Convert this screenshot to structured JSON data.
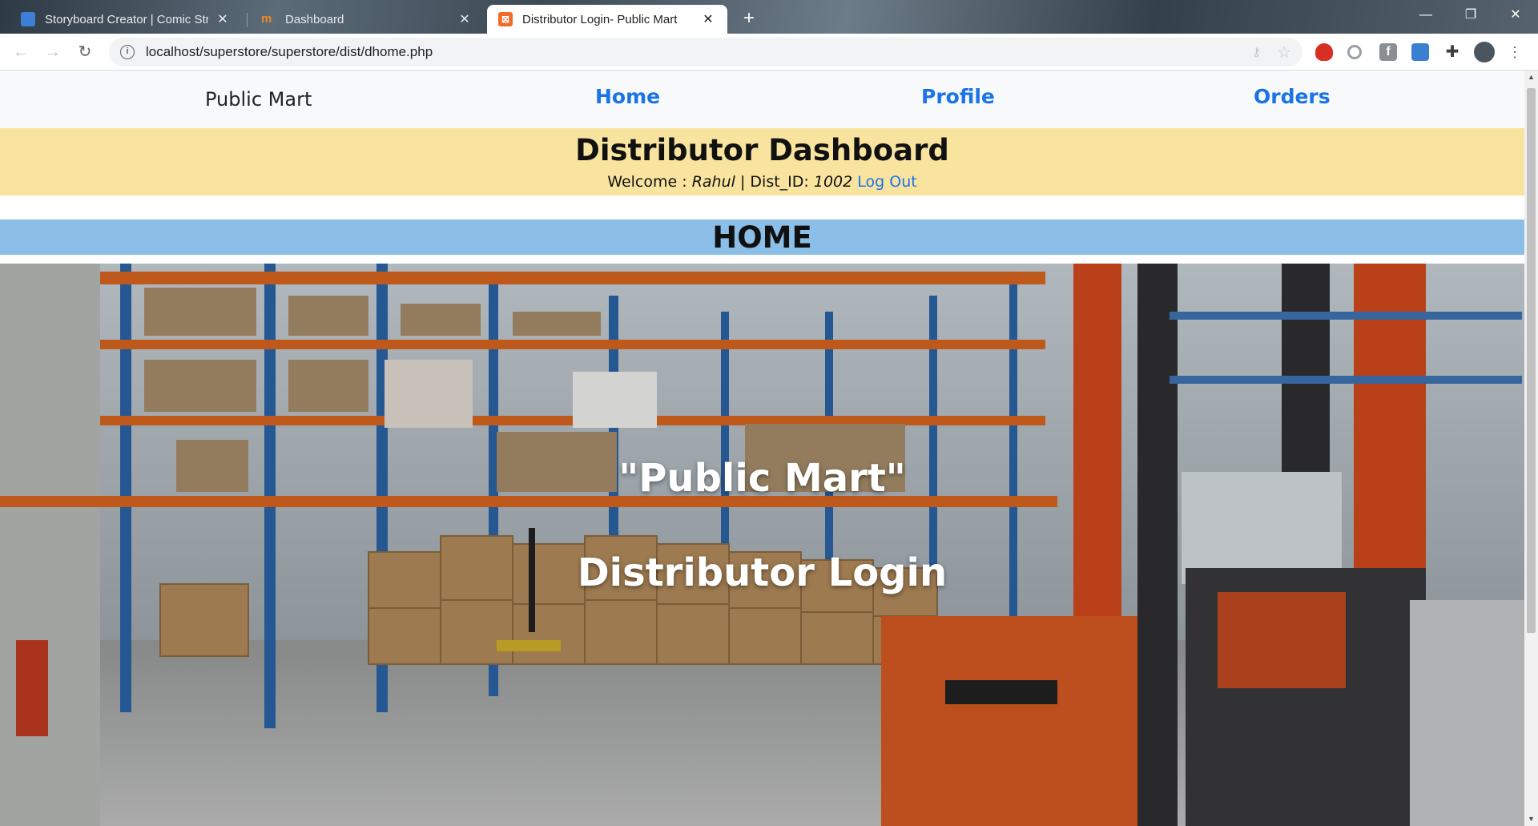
{
  "browser": {
    "tabs": [
      {
        "title": "Storyboard Creator | Comic Strip",
        "favicon": "storyboard-favicon",
        "active": false
      },
      {
        "title": "Dashboard",
        "favicon": "dashboard-favicon",
        "active": false
      },
      {
        "title": "Distributor Login- Public Mart",
        "favicon": "xampp-favicon",
        "active": true
      }
    ],
    "url": "localhost/superstore/superstore/dist/dhome.php"
  },
  "nav": {
    "brand": "Public Mart",
    "links": [
      "Home",
      "Profile",
      "Orders"
    ]
  },
  "dashboard": {
    "title": "Distributor Dashboard",
    "welcome_label": "Welcome :",
    "user_name": "Rahul",
    "separator": "|",
    "dist_label": "Dist_ID:",
    "dist_id": "1002",
    "logout": "Log Out"
  },
  "section": {
    "title": "HOME"
  },
  "hero": {
    "line1": "\"Public Mart\"",
    "line2": "Distributor Login"
  },
  "colors": {
    "banner": "#f9e49f",
    "section_bar": "#8bbfe8",
    "link": "#1a73e8"
  }
}
